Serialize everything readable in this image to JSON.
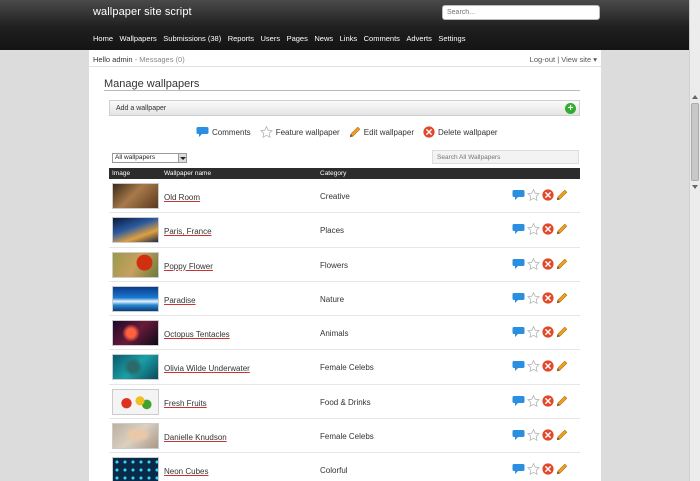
{
  "header": {
    "site_title": "wallpaper site script",
    "search_placeholder": "Search...",
    "nav": [
      {
        "label": "Home"
      },
      {
        "label": "Wallpapers"
      },
      {
        "label": "Submissions (38)"
      },
      {
        "label": "Reports"
      },
      {
        "label": "Users"
      },
      {
        "label": "Pages"
      },
      {
        "label": "News"
      },
      {
        "label": "Links"
      },
      {
        "label": "Comments"
      },
      {
        "label": "Adverts"
      },
      {
        "label": "Settings"
      }
    ]
  },
  "topbar": {
    "hello": "Hello admin",
    "separator": "-",
    "messages": "Messages (0)",
    "logout": "Log-out",
    "divider": "|",
    "view_site": "View site",
    "chevron": "▾"
  },
  "main": {
    "title": "Manage wallpapers",
    "add_label": "Add a wallpaper",
    "legend": {
      "comments": "Comments",
      "feature": "Feature wallpaper",
      "edit": "Edit wallpaper",
      "delete": "Delete wallpaper"
    },
    "filter_selected": "All wallpapers",
    "search_placeholder": "Search All Wallpapers",
    "table": {
      "headers": {
        "image": "Image",
        "name": "Wallpaper name",
        "category": "Category"
      },
      "rows": [
        {
          "name": "Old Room",
          "category": "Creative"
        },
        {
          "name": "Paris, France",
          "category": "Places"
        },
        {
          "name": "Poppy Flower",
          "category": "Flowers"
        },
        {
          "name": "Paradise",
          "category": "Nature"
        },
        {
          "name": "Octopus Tentacles",
          "category": "Animals"
        },
        {
          "name": "Olivia Wilde Underwater",
          "category": "Female Celebs"
        },
        {
          "name": "Fresh Fruits",
          "category": "Food & Drinks"
        },
        {
          "name": "Danielle Knudson",
          "category": "Female Celebs"
        },
        {
          "name": "Neon Cubes",
          "category": "Colorful"
        }
      ]
    }
  },
  "colors": {
    "header_bg": "#1f1f1f",
    "add_icon": "#2eae2e",
    "comment_icon": "#2a8fe0",
    "delete_icon": "#e04a2a",
    "edit_icon": "#f0a020",
    "name_underline": "#cc3333"
  },
  "icons": [
    "comment-bubble-icon",
    "star-icon",
    "pencil-icon",
    "delete-icon",
    "plus-icon"
  ]
}
